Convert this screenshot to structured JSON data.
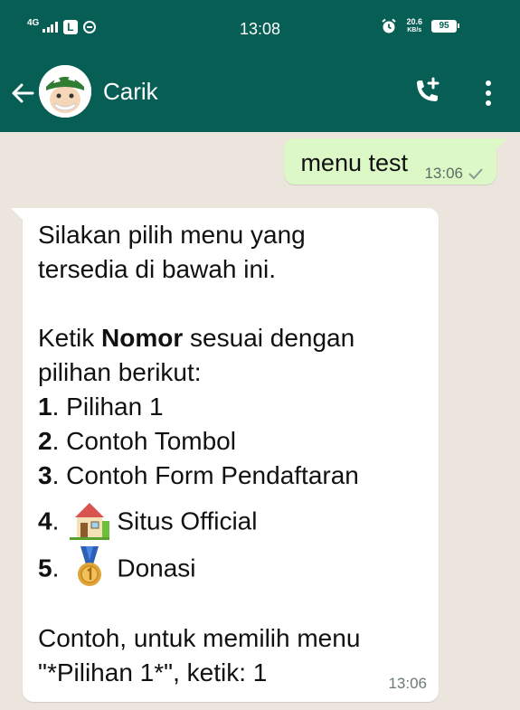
{
  "status_bar": {
    "network": "4G",
    "time": "13:08",
    "speed_top": "20.6",
    "speed_unit": "KB/s",
    "battery": "95"
  },
  "header": {
    "contact_name": "Carik",
    "icons": [
      "back-arrow-icon",
      "avatar",
      "add-call-icon",
      "more-menu-icon"
    ]
  },
  "messages": {
    "outgoing": {
      "text": "menu test",
      "time": "13:06",
      "status_icon": "check-icon"
    },
    "incoming": {
      "line1": "Silakan pilih menu yang",
      "line2": "tersedia di bawah ini.",
      "line3_pre": "Ketik ",
      "line3_bold": "Nomor",
      "line3_post": " sesuai dengan",
      "line4": "pilihan berikut:",
      "items": [
        {
          "num": "1",
          "label": ". Pilihan 1"
        },
        {
          "num": "2",
          "label": ". Contoh Tombol"
        },
        {
          "num": "3",
          "label": ". Contoh Form Pendaftaran"
        },
        {
          "num": "4",
          "label": "Situs Official",
          "icon": "house-emoji-icon"
        },
        {
          "num": "5",
          "label": "Donasi",
          "icon": "medal-emoji-icon"
        }
      ],
      "item_dot": ".",
      "footer1": "Contoh, untuk memilih menu",
      "footer2": "\"*Pilihan 1*\", ketik: 1",
      "time": "13:06"
    }
  },
  "colors": {
    "header": "#075e54",
    "chat_bg": "#ece5dd",
    "outgoing_bubble": "#dcf8c6",
    "incoming_bubble": "#ffffff"
  }
}
